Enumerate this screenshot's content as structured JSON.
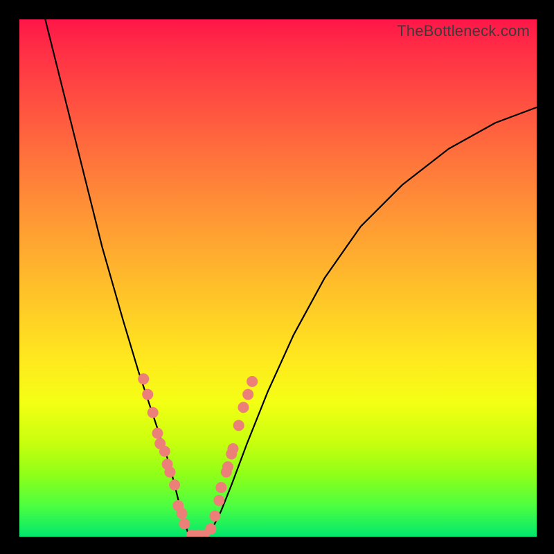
{
  "watermark": "TheBottleneck.com",
  "chart_data": {
    "type": "line",
    "title": "",
    "xlabel": "",
    "ylabel": "",
    "xlim": [
      0,
      100
    ],
    "ylim": [
      0,
      100
    ],
    "grid": false,
    "legend": false,
    "curve_left": {
      "description": "steep descending branch from upper-left to valley floor",
      "x": [
        5,
        8,
        12,
        16,
        20,
        23,
        25,
        27,
        29,
        30.5,
        31.5,
        32.5,
        33
      ],
      "y": [
        100,
        88,
        72,
        56,
        42,
        32,
        26,
        20,
        14,
        8,
        4,
        1,
        0
      ]
    },
    "curve_right": {
      "description": "ascending branch from valley floor rising to upper-right, concave",
      "x": [
        36,
        37.5,
        39,
        41,
        44,
        48,
        53,
        59,
        66,
        74,
        83,
        92,
        100
      ],
      "y": [
        0,
        2,
        5,
        10,
        18,
        28,
        39,
        50,
        60,
        68,
        75,
        80,
        83
      ]
    },
    "valley_floor": {
      "x": [
        33,
        36
      ],
      "y": [
        0,
        0
      ]
    },
    "markers": {
      "description": "salmon dots clustered on lower portions of both branches near the valley",
      "points": [
        {
          "x": 24.0,
          "y": 30.5
        },
        {
          "x": 24.8,
          "y": 27.5
        },
        {
          "x": 25.8,
          "y": 24.0
        },
        {
          "x": 26.7,
          "y": 20.0
        },
        {
          "x": 27.2,
          "y": 18.0
        },
        {
          "x": 28.1,
          "y": 16.5
        },
        {
          "x": 28.6,
          "y": 14.0
        },
        {
          "x": 29.1,
          "y": 12.5
        },
        {
          "x": 30.0,
          "y": 10.0
        },
        {
          "x": 30.7,
          "y": 6.0
        },
        {
          "x": 31.4,
          "y": 4.5
        },
        {
          "x": 31.9,
          "y": 2.5
        },
        {
          "x": 33.3,
          "y": 0.3
        },
        {
          "x": 34.5,
          "y": 0.3
        },
        {
          "x": 35.7,
          "y": 0.3
        },
        {
          "x": 37.0,
          "y": 1.5
        },
        {
          "x": 37.8,
          "y": 4.0
        },
        {
          "x": 38.6,
          "y": 7.0
        },
        {
          "x": 39.0,
          "y": 9.5
        },
        {
          "x": 40.0,
          "y": 12.5
        },
        {
          "x": 40.3,
          "y": 13.5
        },
        {
          "x": 41.0,
          "y": 16.0
        },
        {
          "x": 41.3,
          "y": 17.0
        },
        {
          "x": 42.4,
          "y": 21.5
        },
        {
          "x": 43.3,
          "y": 25.0
        },
        {
          "x": 44.2,
          "y": 27.5
        },
        {
          "x": 45.0,
          "y": 30.0
        }
      ],
      "radius_px": 8
    }
  }
}
